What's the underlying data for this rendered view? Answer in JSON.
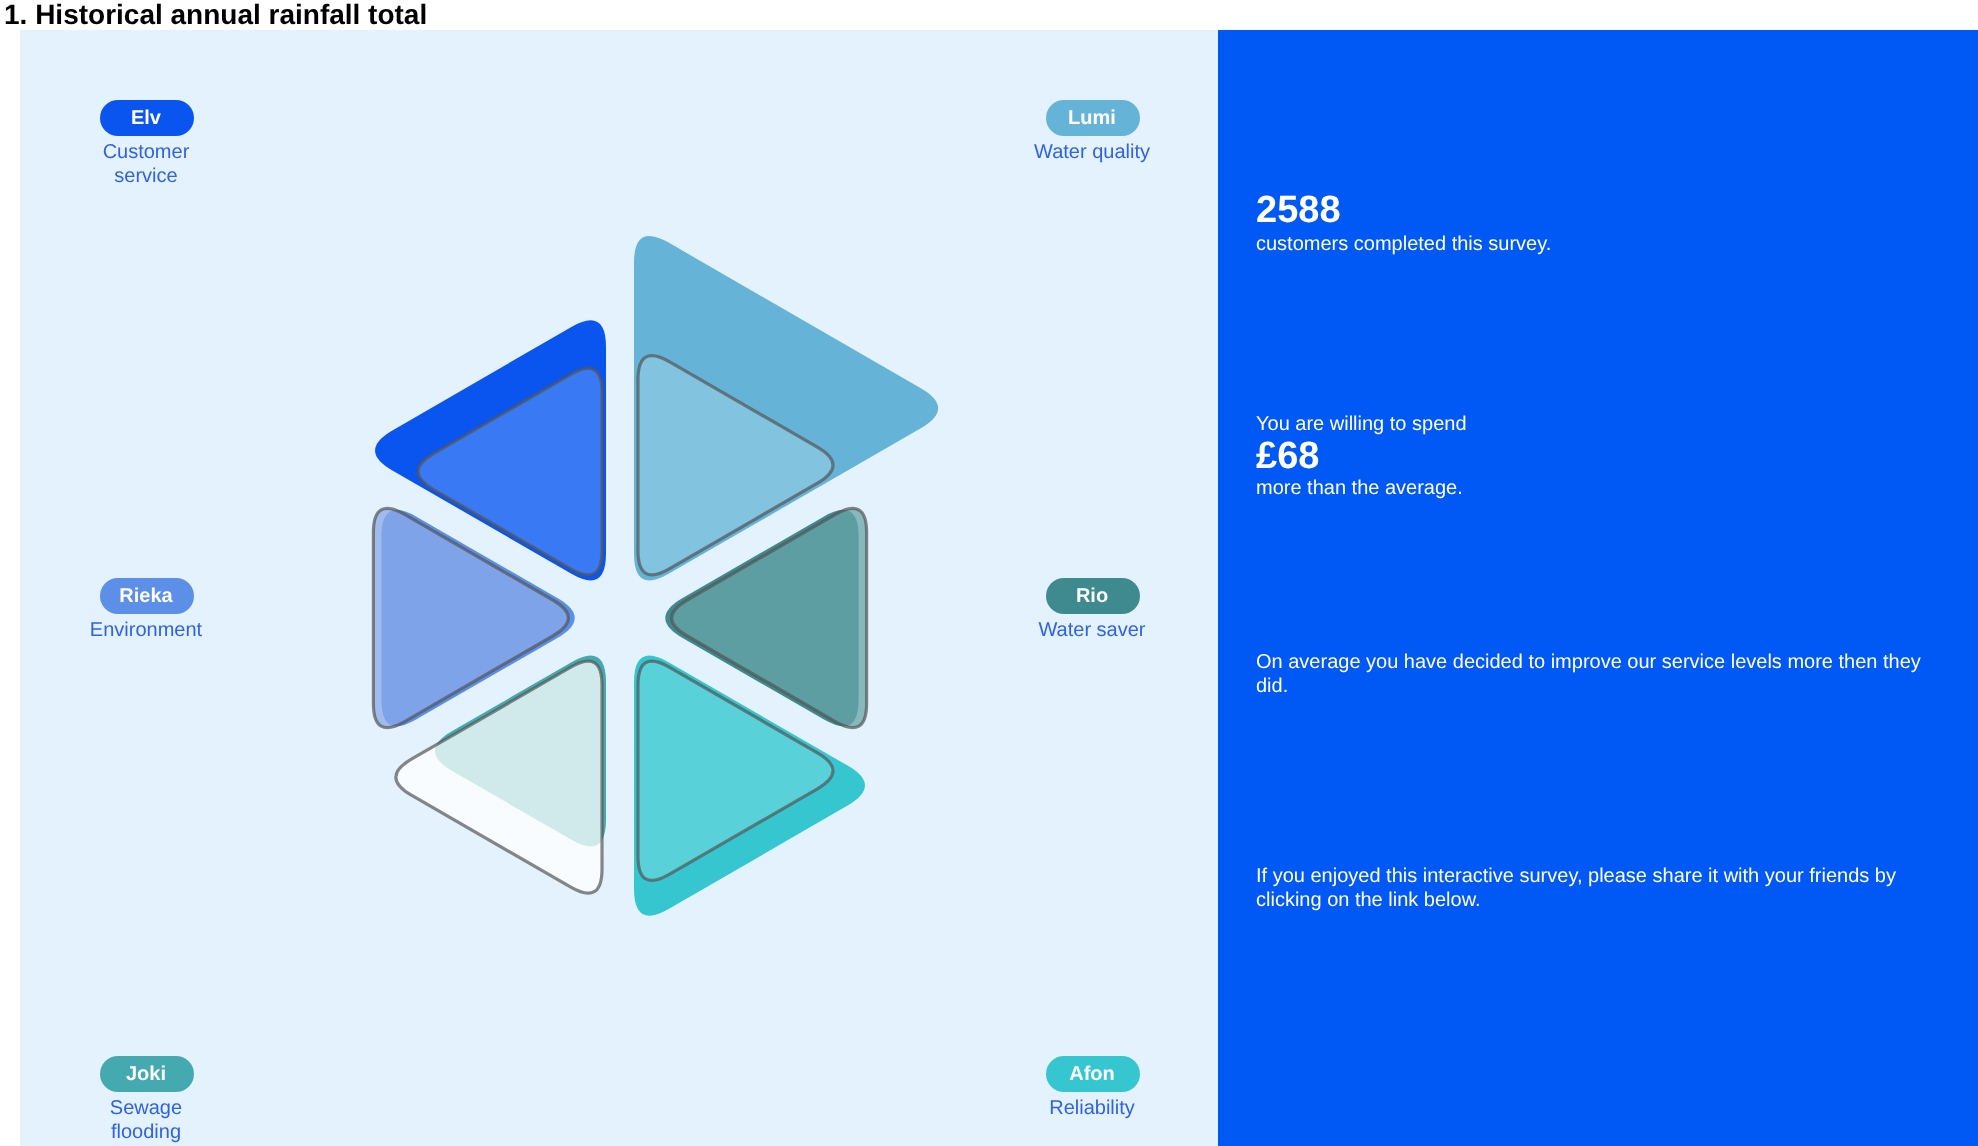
{
  "page_title": "1. Historical annual rainfall total",
  "categories": [
    {
      "name": "Elv",
      "label": "Customer service",
      "color": "#0a55f0"
    },
    {
      "name": "Lumi",
      "label": "Water quality",
      "color": "#66b3d8"
    },
    {
      "name": "Rieka",
      "label": "Environment",
      "color": "#5b8fe8"
    },
    {
      "name": "Rio",
      "label": "Water saver",
      "color": "#3e8a8f"
    },
    {
      "name": "Joki",
      "label": "Sewage flooding",
      "color": "#45aab0"
    },
    {
      "name": "Afon",
      "label": "Reliability",
      "color": "#36c6d0"
    }
  ],
  "summary": {
    "customers_count": "2588",
    "customers_text": "customers completed this survey.",
    "spend_intro": "You are willing to spend",
    "spend_amount": "£68",
    "spend_text": "more than the average.",
    "comparison": "On average you have decided to improve our service levels more then they did.",
    "share": "If you enjoyed this interactive survey, please share it with your friends by clicking on the link below."
  }
}
